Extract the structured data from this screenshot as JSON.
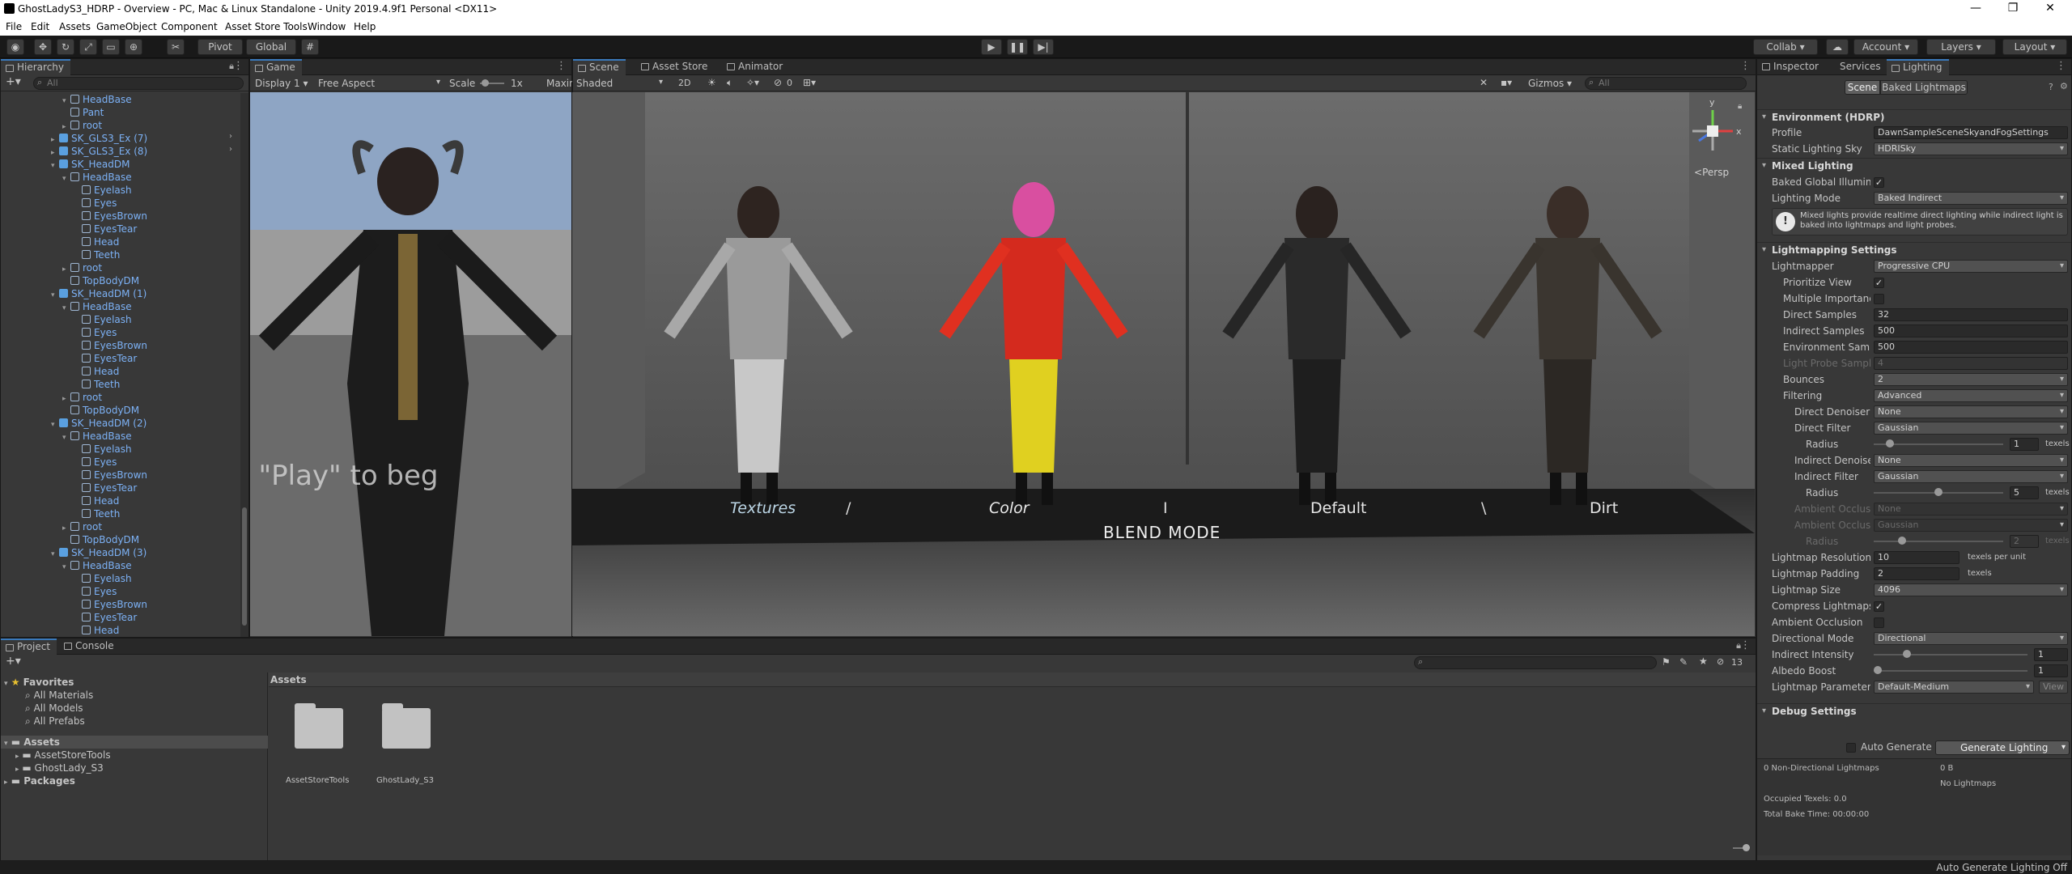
{
  "window": {
    "title": "GhostLadyS3_HDRP - Overview - PC, Mac & Linux Standalone - Unity 2019.4.9f1 Personal <DX11>",
    "controls": [
      "—",
      "❐",
      "✕"
    ]
  },
  "menu": [
    "File",
    "Edit",
    "Assets",
    "GameObject",
    "Component",
    "Asset Store Tools",
    "Window",
    "Help"
  ],
  "toolbar": {
    "pivot": "Pivot",
    "global": "Global",
    "collab": "Collab ▾",
    "account": "Account",
    "layers": "Layers",
    "layout": "Layout"
  },
  "hierarchy": {
    "tab": "Hierarchy",
    "search_placeholder": "All",
    "rows": [
      {
        "label": "HeadBase",
        "indent": 2,
        "fold": "▾",
        "prefab": false
      },
      {
        "label": "Pant",
        "indent": 2,
        "fold": "",
        "prefab": false
      },
      {
        "label": "root",
        "indent": 2,
        "fold": "▸",
        "prefab": false
      },
      {
        "label": "SK_GLS3_Ex (7)",
        "indent": 1,
        "fold": "▸",
        "prefab": true,
        "arrow": true
      },
      {
        "label": "SK_GLS3_Ex (8)",
        "indent": 1,
        "fold": "▸",
        "prefab": true,
        "arrow": true
      },
      {
        "label": "SK_HeadDM",
        "indent": 1,
        "fold": "▾",
        "prefab": true
      },
      {
        "label": "HeadBase",
        "indent": 2,
        "fold": "▾",
        "prefab": false
      },
      {
        "label": "Eyelash",
        "indent": 3,
        "fold": "",
        "prefab": false
      },
      {
        "label": "Eyes",
        "indent": 3,
        "fold": "",
        "prefab": false
      },
      {
        "label": "EyesBrown",
        "indent": 3,
        "fold": "",
        "prefab": false
      },
      {
        "label": "EyesTear",
        "indent": 3,
        "fold": "",
        "prefab": false
      },
      {
        "label": "Head",
        "indent": 3,
        "fold": "",
        "prefab": false
      },
      {
        "label": "Teeth",
        "indent": 3,
        "fold": "",
        "prefab": false
      },
      {
        "label": "root",
        "indent": 2,
        "fold": "▸",
        "prefab": false
      },
      {
        "label": "TopBodyDM",
        "indent": 2,
        "fold": "",
        "prefab": false
      },
      {
        "label": "SK_HeadDM (1)",
        "indent": 1,
        "fold": "▾",
        "prefab": true
      },
      {
        "label": "HeadBase",
        "indent": 2,
        "fold": "▾",
        "prefab": false
      },
      {
        "label": "Eyelash",
        "indent": 3,
        "fold": "",
        "prefab": false
      },
      {
        "label": "Eyes",
        "indent": 3,
        "fold": "",
        "prefab": false
      },
      {
        "label": "EyesBrown",
        "indent": 3,
        "fold": "",
        "prefab": false
      },
      {
        "label": "EyesTear",
        "indent": 3,
        "fold": "",
        "prefab": false
      },
      {
        "label": "Head",
        "indent": 3,
        "fold": "",
        "prefab": false
      },
      {
        "label": "Teeth",
        "indent": 3,
        "fold": "",
        "prefab": false
      },
      {
        "label": "root",
        "indent": 2,
        "fold": "▸",
        "prefab": false
      },
      {
        "label": "TopBodyDM",
        "indent": 2,
        "fold": "",
        "prefab": false
      },
      {
        "label": "SK_HeadDM (2)",
        "indent": 1,
        "fold": "▾",
        "prefab": true
      },
      {
        "label": "HeadBase",
        "indent": 2,
        "fold": "▾",
        "prefab": false
      },
      {
        "label": "Eyelash",
        "indent": 3,
        "fold": "",
        "prefab": false
      },
      {
        "label": "Eyes",
        "indent": 3,
        "fold": "",
        "prefab": false
      },
      {
        "label": "EyesBrown",
        "indent": 3,
        "fold": "",
        "prefab": false
      },
      {
        "label": "EyesTear",
        "indent": 3,
        "fold": "",
        "prefab": false
      },
      {
        "label": "Head",
        "indent": 3,
        "fold": "",
        "prefab": false
      },
      {
        "label": "Teeth",
        "indent": 3,
        "fold": "",
        "prefab": false
      },
      {
        "label": "root",
        "indent": 2,
        "fold": "▸",
        "prefab": false
      },
      {
        "label": "TopBodyDM",
        "indent": 2,
        "fold": "",
        "prefab": false
      },
      {
        "label": "SK_HeadDM (3)",
        "indent": 1,
        "fold": "▾",
        "prefab": true
      },
      {
        "label": "HeadBase",
        "indent": 2,
        "fold": "▾",
        "prefab": false
      },
      {
        "label": "Eyelash",
        "indent": 3,
        "fold": "",
        "prefab": false
      },
      {
        "label": "Eyes",
        "indent": 3,
        "fold": "",
        "prefab": false
      },
      {
        "label": "EyesBrown",
        "indent": 3,
        "fold": "",
        "prefab": false
      },
      {
        "label": "EyesTear",
        "indent": 3,
        "fold": "",
        "prefab": false
      },
      {
        "label": "Head",
        "indent": 3,
        "fold": "",
        "prefab": false
      }
    ]
  },
  "game": {
    "tab": "Game",
    "display": "Display 1",
    "aspect": "Free Aspect",
    "scale_label": "Scale",
    "scale_value": "1x",
    "maximize": "Maxin",
    "overlay_text": "k \"Play\" to beg"
  },
  "scene": {
    "tabs": [
      "Scene",
      "Asset Store",
      "Animator"
    ],
    "shading": "Shaded",
    "mode2d": "2D",
    "hidden_count": "0",
    "gizmos": "Gizmos",
    "search_placeholder": "All",
    "persp": "Persp",
    "axis_y": "y",
    "axis_x": "x",
    "floor_labels": [
      "Textures",
      "/",
      "Color",
      "I",
      "Default",
      "\\",
      "Dirt"
    ],
    "blend_mode": "BLEND MODE"
  },
  "inspector": {
    "tabs": [
      "Inspector",
      "Services",
      "Lighting"
    ],
    "subtabs": [
      "Scene",
      "Baked Lightmaps"
    ],
    "env_header": "Environment (HDRP)",
    "profile_label": "Profile",
    "profile_value": "DawnSampleSceneSkyandFogSettings",
    "static_sky_label": "Static Lighting Sky",
    "static_sky_value": "HDRISky",
    "mixed_header": "Mixed Lighting",
    "baked_gi_label": "Baked Global Illumina",
    "lighting_mode_label": "Lighting Mode",
    "lighting_mode_value": "Baked Indirect",
    "info_text": "Mixed lights provide realtime direct lighting while indirect light is baked into lightmaps and light probes.",
    "lightmapping_header": "Lightmapping Settings",
    "rows": [
      {
        "label": "Lightmapper",
        "value": "Progressive CPU",
        "type": "dd",
        "indent": 0
      },
      {
        "label": "Prioritize View",
        "value": "✓",
        "type": "chk",
        "indent": 1
      },
      {
        "label": "Multiple Importanc",
        "value": "",
        "type": "chk",
        "indent": 1
      },
      {
        "label": "Direct Samples",
        "value": "32",
        "type": "field",
        "indent": 1
      },
      {
        "label": "Indirect Samples",
        "value": "500",
        "type": "field",
        "indent": 1
      },
      {
        "label": "Environment Samp",
        "value": "500",
        "type": "field",
        "indent": 1
      },
      {
        "label": "Light Probe Sampl",
        "value": "4",
        "type": "field",
        "indent": 1,
        "disabled": true
      },
      {
        "label": "Bounces",
        "value": "2",
        "type": "dd",
        "indent": 1
      },
      {
        "label": "Filtering",
        "value": "Advanced",
        "type": "dd",
        "indent": 1
      },
      {
        "label": "Direct Denoiser",
        "value": "None",
        "type": "dd",
        "indent": 2
      },
      {
        "label": "Direct Filter",
        "value": "Gaussian",
        "type": "dd",
        "indent": 2
      },
      {
        "label": "Radius",
        "value": "1",
        "type": "slider",
        "level": 0.1,
        "unit": "texels",
        "indent": 3
      },
      {
        "label": "Indirect Denoise",
        "value": "None",
        "type": "dd",
        "indent": 2
      },
      {
        "label": "Indirect Filter",
        "value": "Gaussian",
        "type": "dd",
        "indent": 2
      },
      {
        "label": "Radius",
        "value": "5",
        "type": "slider",
        "level": 0.5,
        "unit": "texels",
        "indent": 3
      },
      {
        "label": "Ambient Occlus",
        "value": "None",
        "type": "dd",
        "indent": 2,
        "disabled": true
      },
      {
        "label": "Ambient Occlus",
        "value": "Gaussian",
        "type": "dd",
        "indent": 2,
        "disabled": true
      },
      {
        "label": "Radius",
        "value": "2",
        "type": "slider",
        "level": 0.2,
        "unit": "texels",
        "indent": 3,
        "disabled": true
      },
      {
        "label": "Lightmap Resolution",
        "value": "10",
        "type": "unitfield",
        "unit": "texels per unit",
        "indent": 0
      },
      {
        "label": "Lightmap Padding",
        "value": "2",
        "type": "unitfield",
        "unit": "texels",
        "indent": 0
      },
      {
        "label": "Lightmap Size",
        "value": "4096",
        "type": "dd",
        "indent": 0
      },
      {
        "label": "Compress Lightmaps",
        "value": "✓",
        "type": "chk",
        "indent": 0
      },
      {
        "label": "Ambient Occlusion",
        "value": "",
        "type": "chk",
        "indent": 0
      },
      {
        "label": "Directional Mode",
        "value": "Directional",
        "type": "dd",
        "indent": 0
      },
      {
        "label": "Indirect Intensity",
        "value": "1",
        "type": "slider",
        "level": 0.2,
        "unit": "",
        "indent": 0
      },
      {
        "label": "Albedo Boost",
        "value": "1",
        "type": "slider",
        "level": 0.0,
        "unit": "",
        "indent": 0
      },
      {
        "label": "Lightmap Parameters",
        "value": "Default-Medium",
        "type": "ddview",
        "button": "View",
        "indent": 0
      }
    ],
    "debug_header": "Debug Settings",
    "auto_generate": "Auto Generate",
    "generate_btn": "Generate Lighting",
    "stats_left": [
      "0 Non-Directional Lightmaps",
      "",
      "Occupied Texels: 0.0",
      "Total Bake Time: 00:00:00"
    ],
    "stats_right": [
      "0 B",
      "No Lightmaps"
    ]
  },
  "project": {
    "tabs": [
      "Project",
      "Console"
    ],
    "favorites_label": "Favorites",
    "favorites": [
      "All Materials",
      "All Models",
      "All Prefabs"
    ],
    "assets_label": "Assets",
    "assets_children": [
      "AssetStoreTools",
      "GhostLady_S3"
    ],
    "packages_label": "Packages",
    "breadcrumb": "Assets",
    "items": [
      "AssetStoreTools",
      "GhostLady_S3"
    ],
    "count": "13"
  },
  "statusbar": {
    "text": "Auto Generate Lighting Off"
  },
  "colors": {
    "accent": "#3a79bb",
    "prefab_text": "#7cb1f5",
    "panel": "#383838"
  }
}
